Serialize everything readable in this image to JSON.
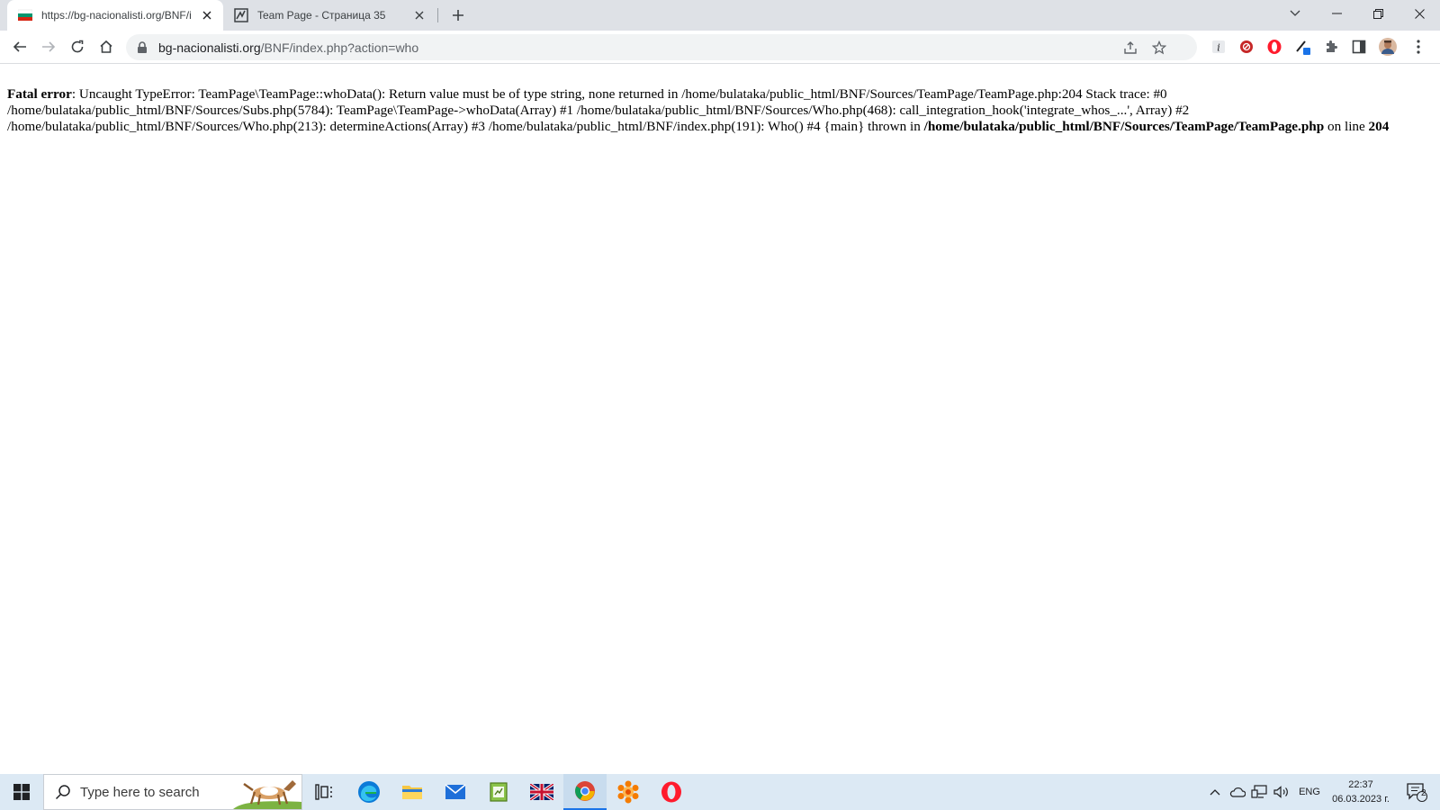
{
  "browser": {
    "tabs": [
      {
        "title": "https://bg-nacionalisti.org/BNF/i",
        "favicon": "bulgarian-flag-icon",
        "active": true
      },
      {
        "title": "Team Page - Страница 35",
        "favicon": "team-logo-icon",
        "active": false
      }
    ],
    "address": {
      "host": "bg-nacionalisti.org",
      "path": "/BNF/index.php?action=who"
    }
  },
  "page": {
    "error_label": "Fatal error",
    "error_text": ": Uncaught TypeError: TeamPage\\TeamPage::whoData(): Return value must be of type string, none returned in /home/bulataka/public_html/BNF/Sources/TeamPage/TeamPage.php:204 Stack trace: #0 /home/bulataka/public_html/BNF/Sources/Subs.php(5784): TeamPage\\TeamPage->whoData(Array) #1 /home/bulataka/public_html/BNF/Sources/Who.php(468): call_integration_hook('integrate_whos_...', Array) #2 /home/bulataka/public_html/BNF/Sources/Who.php(213): determineActions(Array) #3 /home/bulataka/public_html/BNF/index.php(191): Who() #4 {main} thrown in ",
    "error_file": "/home/bulataka/public_html/BNF/Sources/TeamPage/TeamPage.php",
    "on_line_text": " on line ",
    "error_line": "204"
  },
  "taskbar": {
    "search_placeholder": "Type here to search",
    "language": "ENG",
    "time": "22:37",
    "date": "06.03.2023 г.",
    "notification_count": "2"
  },
  "colors": {
    "accent_blue": "#1a73e8",
    "opera_red": "#ff1b2d",
    "taskbar_bg": "#dce9f4"
  }
}
